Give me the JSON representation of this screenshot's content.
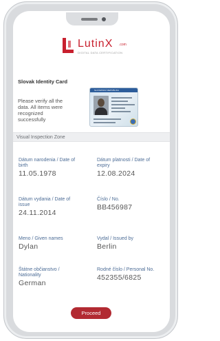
{
  "app": {
    "brand_name": "LutinX",
    "brand_suffix": ".com",
    "brand_tagline": "DIGITAL DATA CERTIFICATION"
  },
  "document": {
    "title": "Slovak Identity Card",
    "message": "Please verify all the data. All items were recognized successfully"
  },
  "id_card": {
    "header_text": "SLOVENSKÁ REPUBLIKA"
  },
  "zone": {
    "label": "Visual Inspection Zone"
  },
  "fields": [
    {
      "label": "Dátum narodenia / Date of birth",
      "value": "11.05.1978"
    },
    {
      "label": "Dátum platnosti / Date of expiry",
      "value": "12.08.2024"
    },
    {
      "label": "Dátum vydania / Date of issue",
      "value": "24.11.2014"
    },
    {
      "label": "Číslo / No.",
      "value": "BB456987"
    },
    {
      "label": "Meno / Given names",
      "value": "Dylan"
    },
    {
      "label": "Vydal / Issued by",
      "value": "Berlin"
    },
    {
      "label": "Štátne občianstvo / Nationality",
      "value": "German"
    },
    {
      "label": "Rodné číslo / Personal No.",
      "value": "452355/6825"
    }
  ],
  "actions": {
    "proceed_label": "Proceed"
  },
  "colors": {
    "brand": "#c8202e",
    "button": "#b22a32",
    "field_label": "#4c6c96"
  }
}
